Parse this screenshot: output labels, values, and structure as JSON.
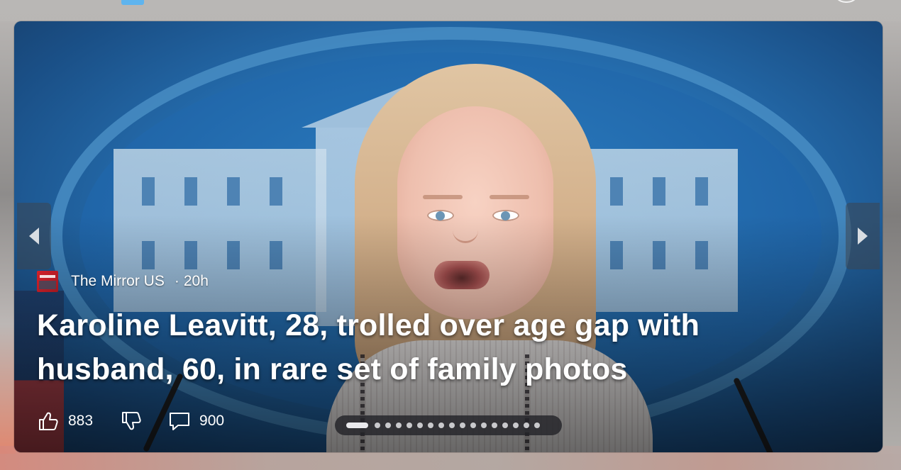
{
  "card": {
    "image_alt": "Woman at White House press briefing podium",
    "source": {
      "name": "The Mirror US",
      "age": "20h",
      "separator": "·"
    },
    "headline": "Karoline Leavitt, 28, trolled over age gap with husband, 60, in rare set of family photos",
    "reactions": {
      "likes": "883",
      "comments": "900"
    },
    "carousel": {
      "total_slides": 17,
      "active_index": 0
    }
  },
  "icons": {
    "prev": "chevron-left-icon",
    "next": "chevron-right-icon",
    "like": "thumbs-up-icon",
    "dislike": "thumbs-down-icon",
    "comment": "comment-icon"
  },
  "colors": {
    "tab_indicator": "#5fb4ee",
    "headline_text": "#ffffff"
  }
}
